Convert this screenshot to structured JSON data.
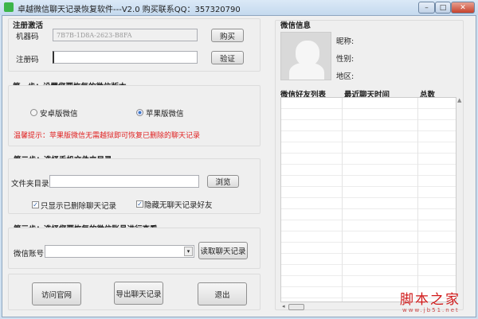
{
  "title": "卓越微信聊天记录恢复软件---V2.0 购买联系QQ：357320790",
  "window_controls": {
    "minimize": "–",
    "maximize": "□",
    "close": "✕"
  },
  "register": {
    "heading": "注册激活",
    "machine_label": "机器码",
    "machine_code": "7B7B-1D8A-2623-B8FA",
    "buy": "购买",
    "reg_label": "注册码",
    "reg_value": "",
    "verify": "验证"
  },
  "step1": {
    "heading": "第一步：设置您要恢复的微信版本",
    "android": "安卓版微信",
    "apple": "苹果版微信",
    "selected": "apple",
    "tip": "温馨提示：苹果版微信无需越狱即可恢复已删除的聊天记录",
    "tip_color": "#e02020"
  },
  "step2": {
    "heading": "第二步：选择手机文件夹目录",
    "folder_label": "文件夹目录：",
    "folder_value": "",
    "browse": "浏览",
    "only_deleted": "只显示已删除聊天记录",
    "only_deleted_checked": true,
    "hide_empty": "隐藏无聊天记录好友",
    "hide_empty_checked": true
  },
  "step3": {
    "heading": "第三步：选择您要恢复的微信账号进行查看",
    "account_label": "微信账号",
    "account_value": "",
    "read": "读取聊天记录"
  },
  "bottom": {
    "visit": "访问官网",
    "export": "导出聊天记录",
    "exit": "退出"
  },
  "info": {
    "heading": "微信信息",
    "nickname": "昵称:",
    "gender": "性别:",
    "region": "地区:"
  },
  "table": {
    "columns": [
      "微信好友列表",
      "最近聊天时间",
      "总数"
    ]
  },
  "watermark": {
    "text": "脚本之家",
    "url": "www.jb51.net"
  }
}
